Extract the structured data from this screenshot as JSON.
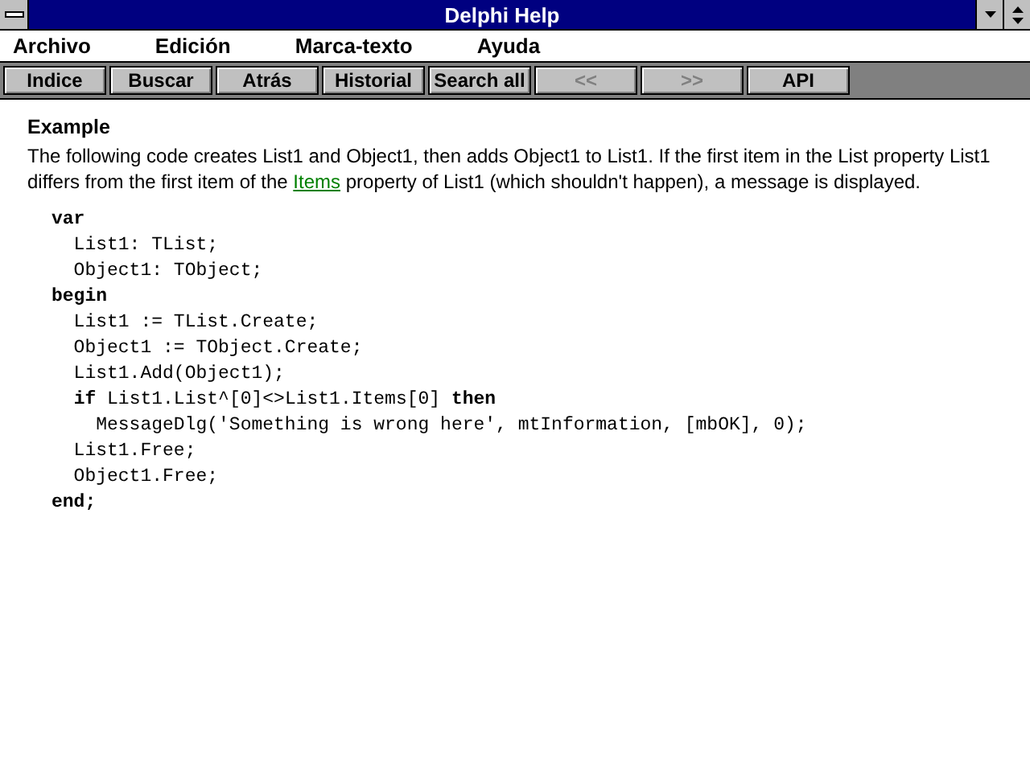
{
  "window": {
    "title": "Delphi Help"
  },
  "menu": [
    "Archivo",
    "Edición",
    "Marca-texto",
    "Ayuda"
  ],
  "buttons": [
    {
      "label": "Indice",
      "disabled": false
    },
    {
      "label": "Buscar",
      "disabled": false
    },
    {
      "label": "Atrás",
      "disabled": false
    },
    {
      "label": "Historial",
      "disabled": false
    },
    {
      "label": "Search all",
      "disabled": false
    },
    {
      "label": "<<",
      "disabled": true
    },
    {
      "label": ">>",
      "disabled": true
    },
    {
      "label": "API",
      "disabled": false
    }
  ],
  "topic": {
    "heading": "Example",
    "paragraph": [
      {
        "kind": "text",
        "text": "The following code creates List1 and Object1, then adds Object1 to List1. If the first item in the List property List1 differs from the first item of the "
      },
      {
        "kind": "link",
        "text": "Items"
      },
      {
        "kind": "text",
        "text": " property of List1 (which shouldn't happen), a message is displayed."
      }
    ],
    "code": [
      "**var**",
      "  List1: TList;",
      "  Object1: TObject;",
      "**begin**",
      "  List1 := TList.Create;",
      "  Object1 := TObject.Create;",
      "  List1.Add(Object1);",
      "  **if** List1.List^[0]<>List1.Items[0] **then**",
      "    MessageDlg('Something is wrong here', mtInformation, [mbOK], 0);",
      "  List1.Free;",
      "  Object1.Free;",
      "**end;**"
    ]
  }
}
